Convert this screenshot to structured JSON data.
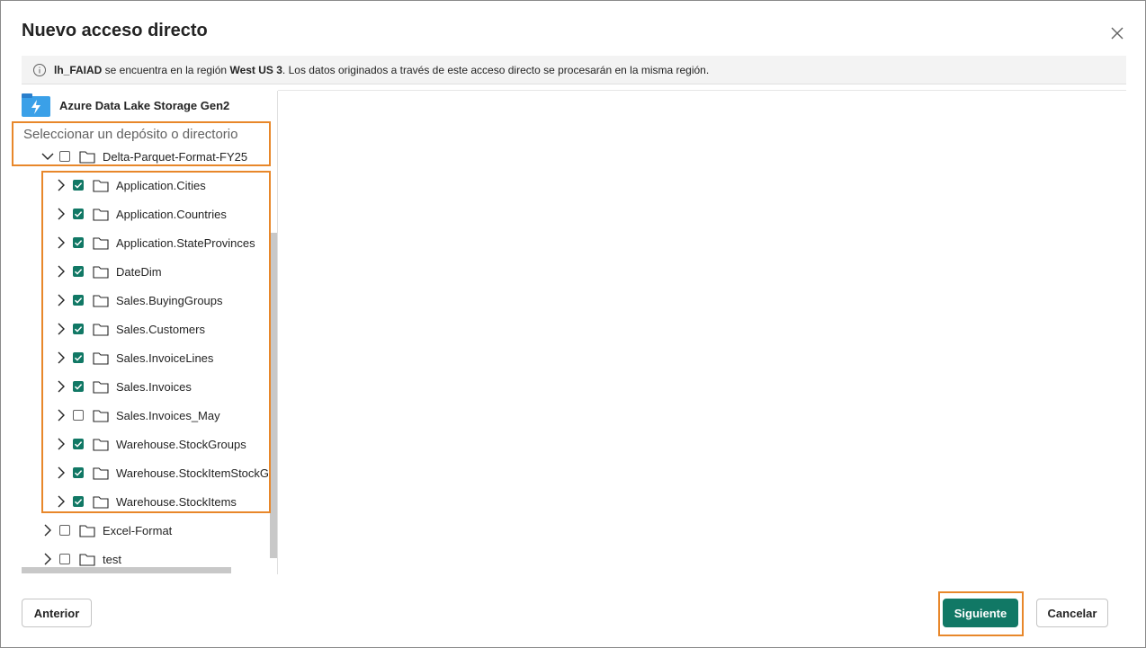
{
  "dialog": {
    "title": "Nuevo acceso directo"
  },
  "info": {
    "lakehouse": "lh_FAIAD",
    "text1": " se encuentra en la región ",
    "region": "West US 3",
    "text2": ". Los datos originados a través de este acceso directo se procesarán en la misma región."
  },
  "source": {
    "name": "Azure Data Lake Storage Gen2"
  },
  "select_label": "Seleccionar un depósito o directorio",
  "tree": {
    "root": {
      "label": "Delta-Parquet-Format-FY25",
      "expanded": true,
      "checked": false
    },
    "children": [
      {
        "label": "Application.Cities",
        "checked": true
      },
      {
        "label": "Application.Countries",
        "checked": true
      },
      {
        "label": "Application.StateProvinces",
        "checked": true
      },
      {
        "label": "DateDim",
        "checked": true
      },
      {
        "label": "Sales.BuyingGroups",
        "checked": true
      },
      {
        "label": "Sales.Customers",
        "checked": true
      },
      {
        "label": "Sales.InvoiceLines",
        "checked": true
      },
      {
        "label": "Sales.Invoices",
        "checked": true
      },
      {
        "label": "Sales.Invoices_May",
        "checked": false
      },
      {
        "label": "Warehouse.StockGroups",
        "checked": true
      },
      {
        "label": "Warehouse.StockItemStockG",
        "checked": true
      },
      {
        "label": "Warehouse.StockItems",
        "checked": true
      }
    ],
    "siblings": [
      {
        "label": "Excel-Format",
        "checked": false
      },
      {
        "label": "test",
        "checked": false
      }
    ]
  },
  "footer": {
    "back_label": "Anterior",
    "next_label": "Siguiente",
    "cancel_label": "Cancelar"
  },
  "colors": {
    "accent": "#117865",
    "highlight": "#e8872a"
  }
}
